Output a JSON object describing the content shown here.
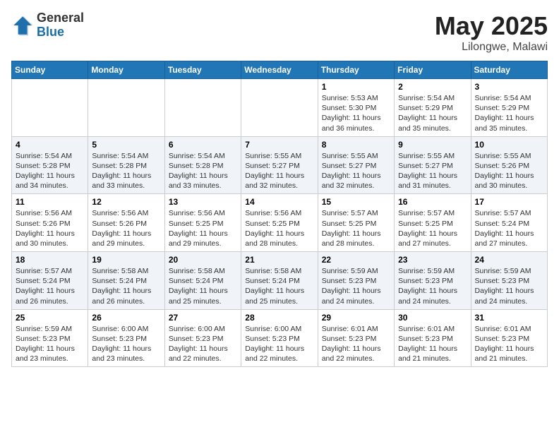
{
  "header": {
    "logo_general": "General",
    "logo_blue": "Blue",
    "month": "May 2025",
    "location": "Lilongwe, Malawi"
  },
  "weekdays": [
    "Sunday",
    "Monday",
    "Tuesday",
    "Wednesday",
    "Thursday",
    "Friday",
    "Saturday"
  ],
  "weeks": [
    [
      {
        "day": "",
        "info": ""
      },
      {
        "day": "",
        "info": ""
      },
      {
        "day": "",
        "info": ""
      },
      {
        "day": "",
        "info": ""
      },
      {
        "day": "1",
        "info": "Sunrise: 5:53 AM\nSunset: 5:30 PM\nDaylight: 11 hours\nand 36 minutes."
      },
      {
        "day": "2",
        "info": "Sunrise: 5:54 AM\nSunset: 5:29 PM\nDaylight: 11 hours\nand 35 minutes."
      },
      {
        "day": "3",
        "info": "Sunrise: 5:54 AM\nSunset: 5:29 PM\nDaylight: 11 hours\nand 35 minutes."
      }
    ],
    [
      {
        "day": "4",
        "info": "Sunrise: 5:54 AM\nSunset: 5:28 PM\nDaylight: 11 hours\nand 34 minutes."
      },
      {
        "day": "5",
        "info": "Sunrise: 5:54 AM\nSunset: 5:28 PM\nDaylight: 11 hours\nand 33 minutes."
      },
      {
        "day": "6",
        "info": "Sunrise: 5:54 AM\nSunset: 5:28 PM\nDaylight: 11 hours\nand 33 minutes."
      },
      {
        "day": "7",
        "info": "Sunrise: 5:55 AM\nSunset: 5:27 PM\nDaylight: 11 hours\nand 32 minutes."
      },
      {
        "day": "8",
        "info": "Sunrise: 5:55 AM\nSunset: 5:27 PM\nDaylight: 11 hours\nand 32 minutes."
      },
      {
        "day": "9",
        "info": "Sunrise: 5:55 AM\nSunset: 5:27 PM\nDaylight: 11 hours\nand 31 minutes."
      },
      {
        "day": "10",
        "info": "Sunrise: 5:55 AM\nSunset: 5:26 PM\nDaylight: 11 hours\nand 30 minutes."
      }
    ],
    [
      {
        "day": "11",
        "info": "Sunrise: 5:56 AM\nSunset: 5:26 PM\nDaylight: 11 hours\nand 30 minutes."
      },
      {
        "day": "12",
        "info": "Sunrise: 5:56 AM\nSunset: 5:26 PM\nDaylight: 11 hours\nand 29 minutes."
      },
      {
        "day": "13",
        "info": "Sunrise: 5:56 AM\nSunset: 5:25 PM\nDaylight: 11 hours\nand 29 minutes."
      },
      {
        "day": "14",
        "info": "Sunrise: 5:56 AM\nSunset: 5:25 PM\nDaylight: 11 hours\nand 28 minutes."
      },
      {
        "day": "15",
        "info": "Sunrise: 5:57 AM\nSunset: 5:25 PM\nDaylight: 11 hours\nand 28 minutes."
      },
      {
        "day": "16",
        "info": "Sunrise: 5:57 AM\nSunset: 5:25 PM\nDaylight: 11 hours\nand 27 minutes."
      },
      {
        "day": "17",
        "info": "Sunrise: 5:57 AM\nSunset: 5:24 PM\nDaylight: 11 hours\nand 27 minutes."
      }
    ],
    [
      {
        "day": "18",
        "info": "Sunrise: 5:57 AM\nSunset: 5:24 PM\nDaylight: 11 hours\nand 26 minutes."
      },
      {
        "day": "19",
        "info": "Sunrise: 5:58 AM\nSunset: 5:24 PM\nDaylight: 11 hours\nand 26 minutes."
      },
      {
        "day": "20",
        "info": "Sunrise: 5:58 AM\nSunset: 5:24 PM\nDaylight: 11 hours\nand 25 minutes."
      },
      {
        "day": "21",
        "info": "Sunrise: 5:58 AM\nSunset: 5:24 PM\nDaylight: 11 hours\nand 25 minutes."
      },
      {
        "day": "22",
        "info": "Sunrise: 5:59 AM\nSunset: 5:23 PM\nDaylight: 11 hours\nand 24 minutes."
      },
      {
        "day": "23",
        "info": "Sunrise: 5:59 AM\nSunset: 5:23 PM\nDaylight: 11 hours\nand 24 minutes."
      },
      {
        "day": "24",
        "info": "Sunrise: 5:59 AM\nSunset: 5:23 PM\nDaylight: 11 hours\nand 24 minutes."
      }
    ],
    [
      {
        "day": "25",
        "info": "Sunrise: 5:59 AM\nSunset: 5:23 PM\nDaylight: 11 hours\nand 23 minutes."
      },
      {
        "day": "26",
        "info": "Sunrise: 6:00 AM\nSunset: 5:23 PM\nDaylight: 11 hours\nand 23 minutes."
      },
      {
        "day": "27",
        "info": "Sunrise: 6:00 AM\nSunset: 5:23 PM\nDaylight: 11 hours\nand 22 minutes."
      },
      {
        "day": "28",
        "info": "Sunrise: 6:00 AM\nSunset: 5:23 PM\nDaylight: 11 hours\nand 22 minutes."
      },
      {
        "day": "29",
        "info": "Sunrise: 6:01 AM\nSunset: 5:23 PM\nDaylight: 11 hours\nand 22 minutes."
      },
      {
        "day": "30",
        "info": "Sunrise: 6:01 AM\nSunset: 5:23 PM\nDaylight: 11 hours\nand 21 minutes."
      },
      {
        "day": "31",
        "info": "Sunrise: 6:01 AM\nSunset: 5:23 PM\nDaylight: 11 hours\nand 21 minutes."
      }
    ]
  ]
}
